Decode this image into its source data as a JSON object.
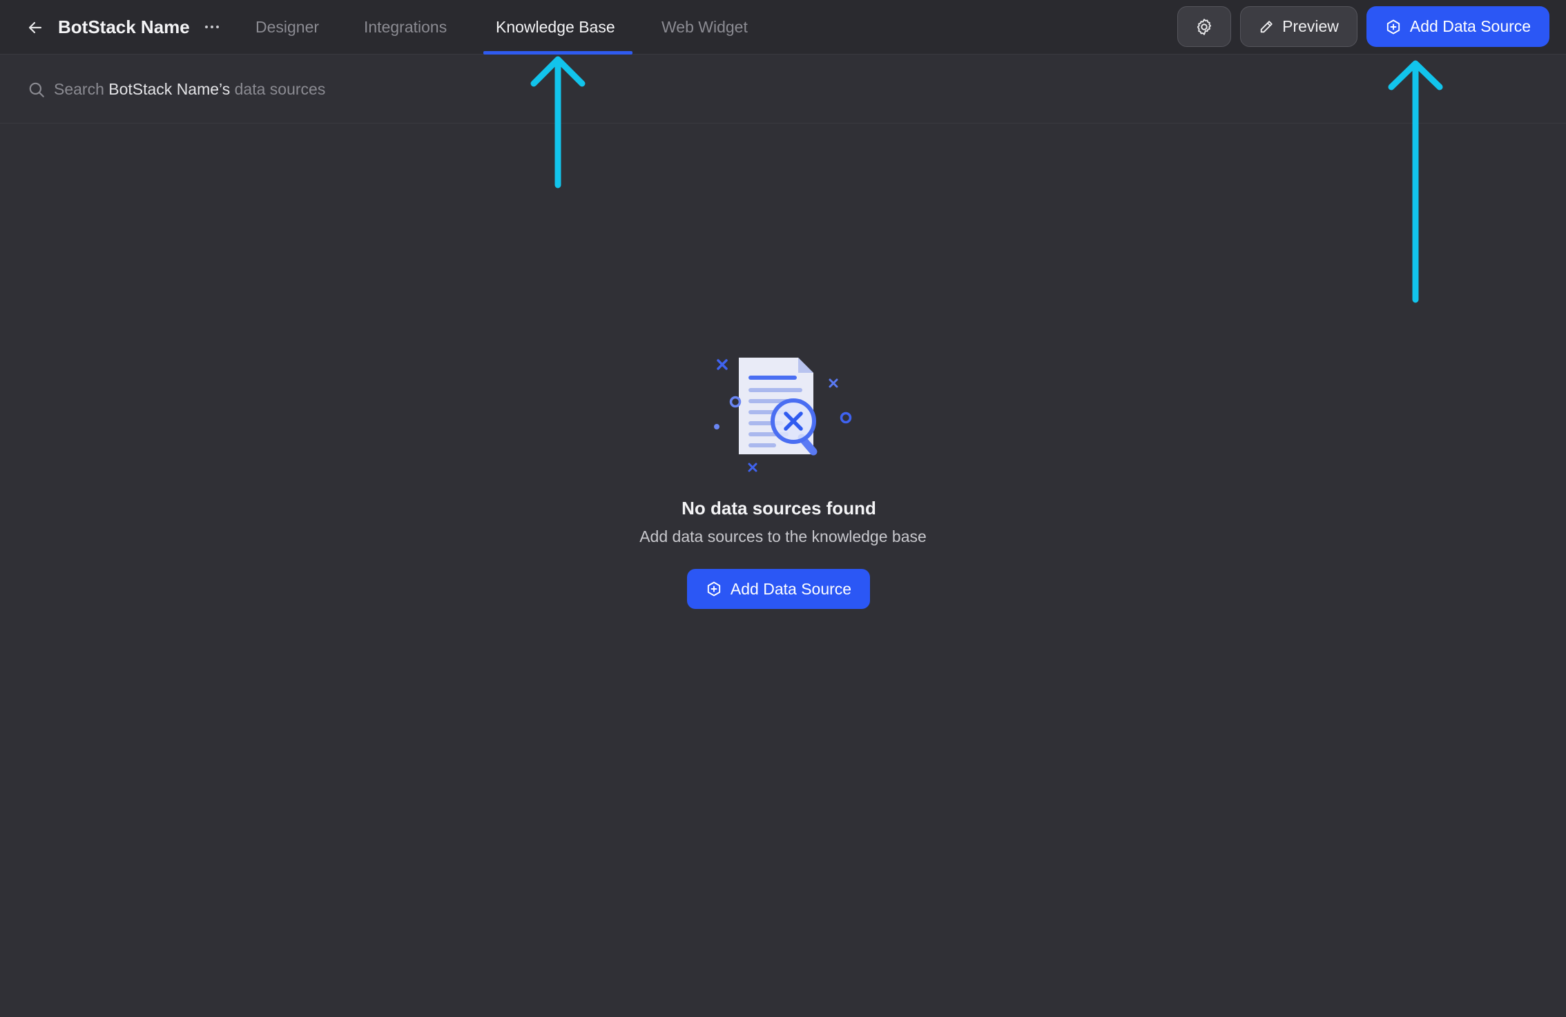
{
  "header": {
    "bot_name": "BotStack Name",
    "tabs": [
      {
        "label": "Designer",
        "active": false
      },
      {
        "label": "Integrations",
        "active": false
      },
      {
        "label": "Knowledge Base",
        "active": true
      },
      {
        "label": "Web Widget",
        "active": false
      }
    ],
    "preview_label": "Preview",
    "add_data_source_label": "Add Data Source"
  },
  "search": {
    "prefix": "Search ",
    "highlight": "BotStack Name’s",
    "suffix": " data sources"
  },
  "empty_state": {
    "title": "No data sources found",
    "subtitle": "Add data sources to the knowledge base",
    "button_label": "Add Data Source"
  },
  "colors": {
    "background": "#303036",
    "accent": "#2b57f5",
    "annotation_arrow": "#12c4ec"
  },
  "icons": {
    "back": "arrow-left-icon",
    "more": "more-horizontal-icon",
    "settings": "gear-icon",
    "preview": "pencil-icon",
    "add": "hexagon-plus-icon",
    "search": "search-icon"
  }
}
